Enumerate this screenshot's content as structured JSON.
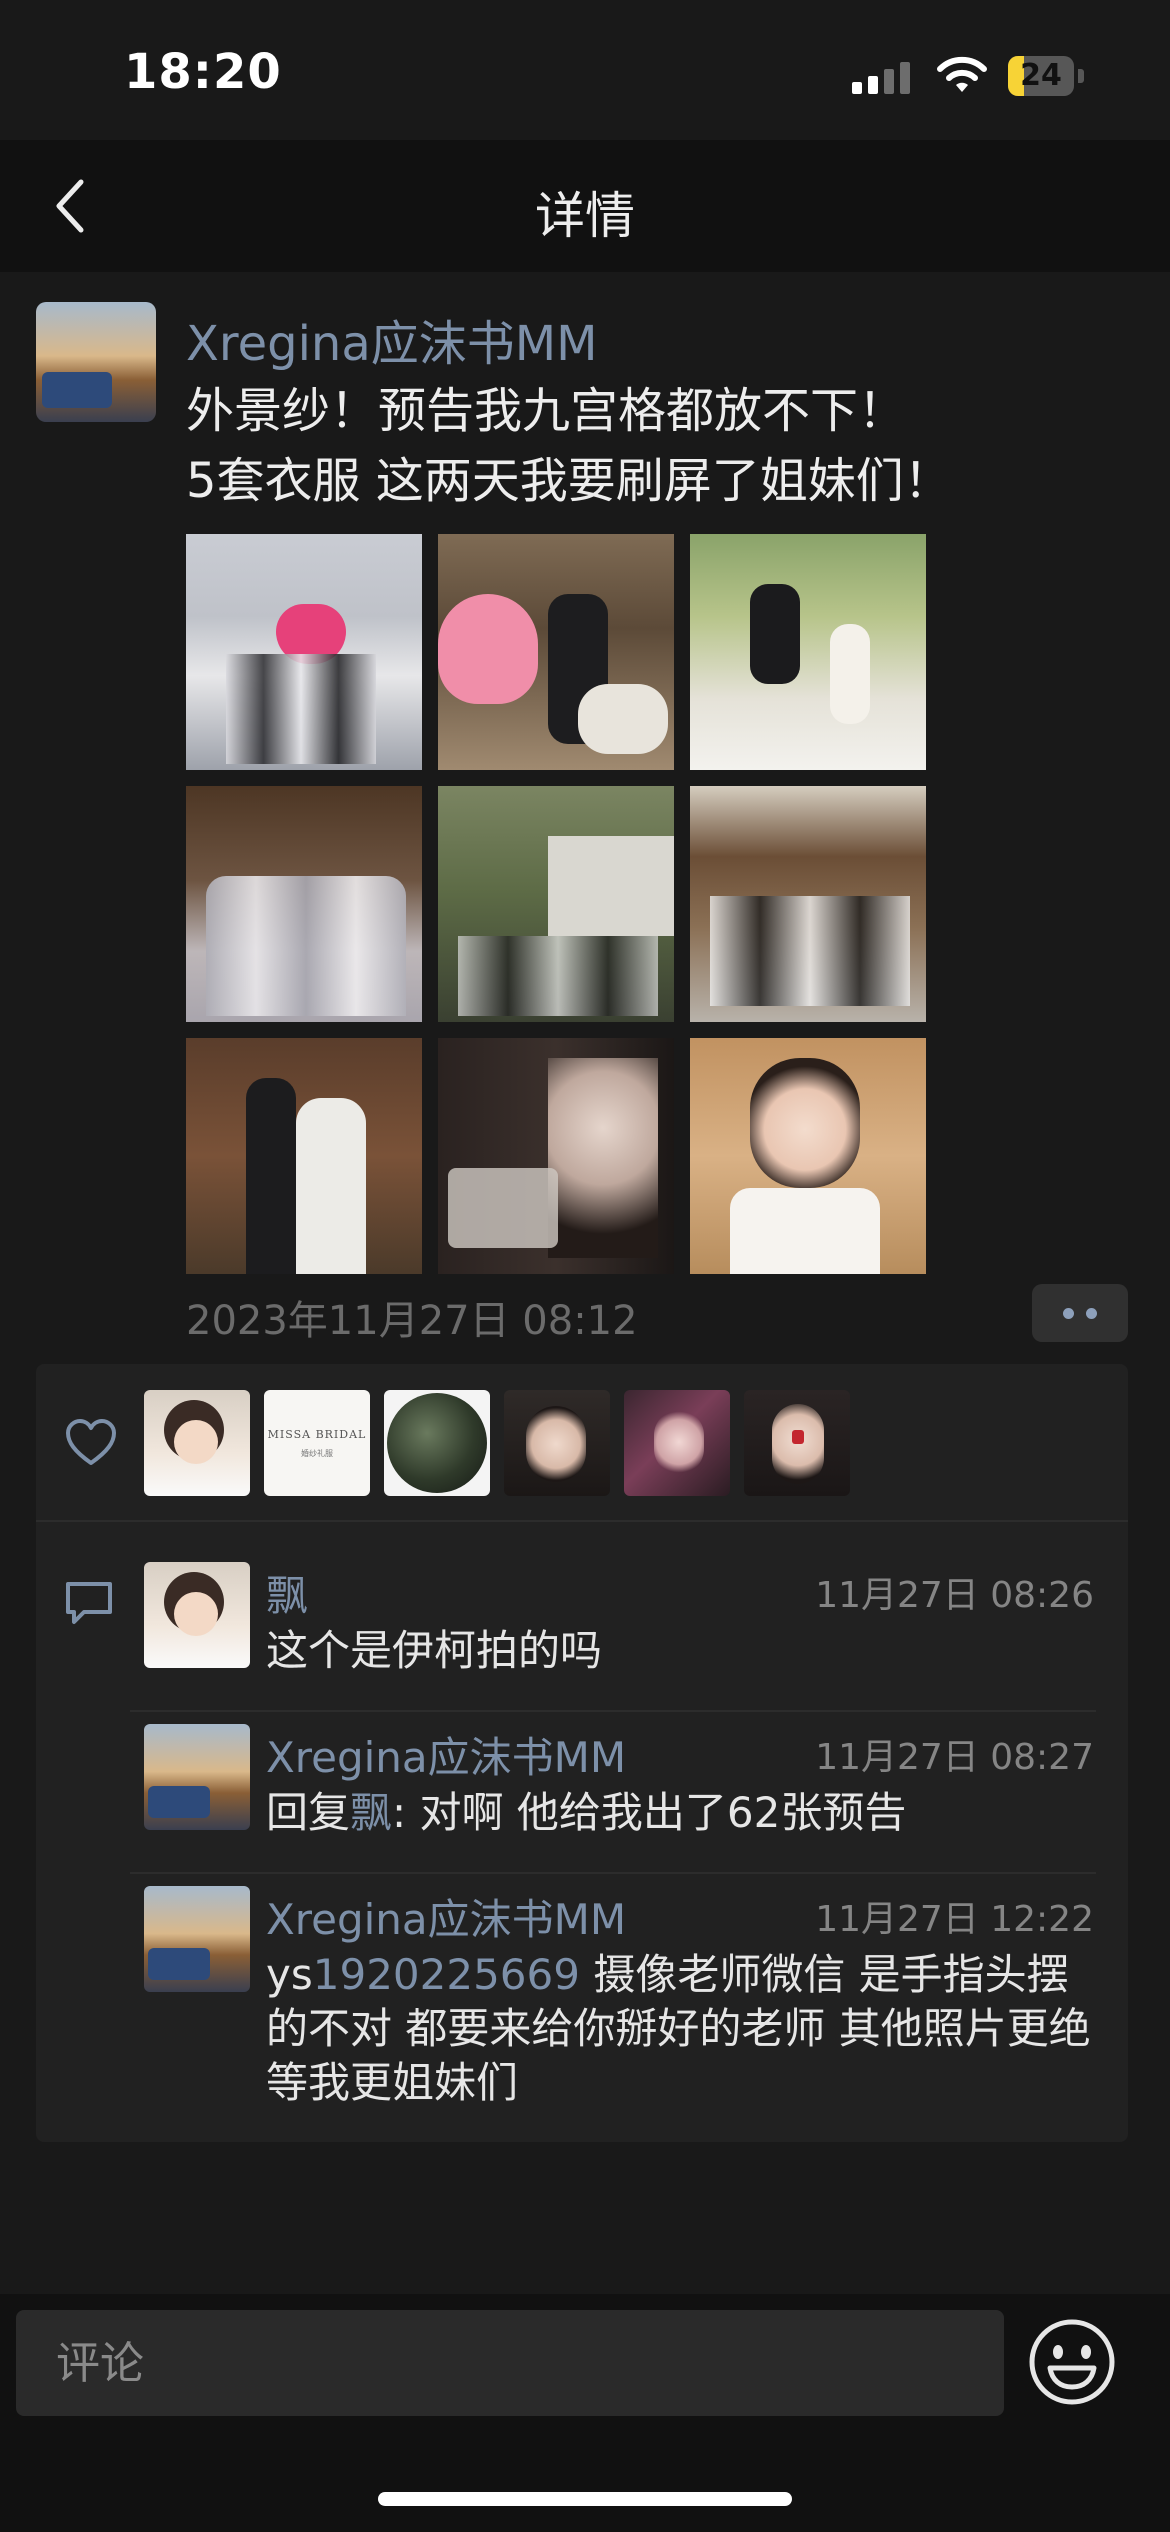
{
  "status_bar": {
    "time": "18:20",
    "battery": "24",
    "battery_level": 0.24
  },
  "nav": {
    "title": "详情"
  },
  "post": {
    "author": "Xregina应沫书MM",
    "text_lines": [
      "外景纱！预告我九宫格都放不下！",
      "5套衣服 这两天我要刷屏了姐妹们！"
    ],
    "timestamp": "2023年11月27日 08:12",
    "photo_count": 9
  },
  "likes": {
    "avatar_count": 6,
    "brand_avatar_text": "MISSA BRIDAL",
    "brand_avatar_subtext": "婚纱礼服"
  },
  "comments": [
    {
      "author": "飘",
      "time": "11月27日 08:26",
      "text": "这个是伊柯拍的吗"
    },
    {
      "author": "Xregina应沫书MM",
      "time": "11月27日 08:27",
      "reply_prefix": "回复",
      "reply_to": "飘",
      "reply_text": ": 对啊 他给我出了62张预告"
    },
    {
      "author": "Xregina应沫书MM",
      "time": "11月27日 12:22",
      "prefix": "ys",
      "link": "1920225669",
      "text": " 摄像老师微信 是手指头摆的不对 都要来给你掰好的老师 其他照片更绝 等我更姐妹们"
    }
  ],
  "input": {
    "placeholder": "评论"
  }
}
